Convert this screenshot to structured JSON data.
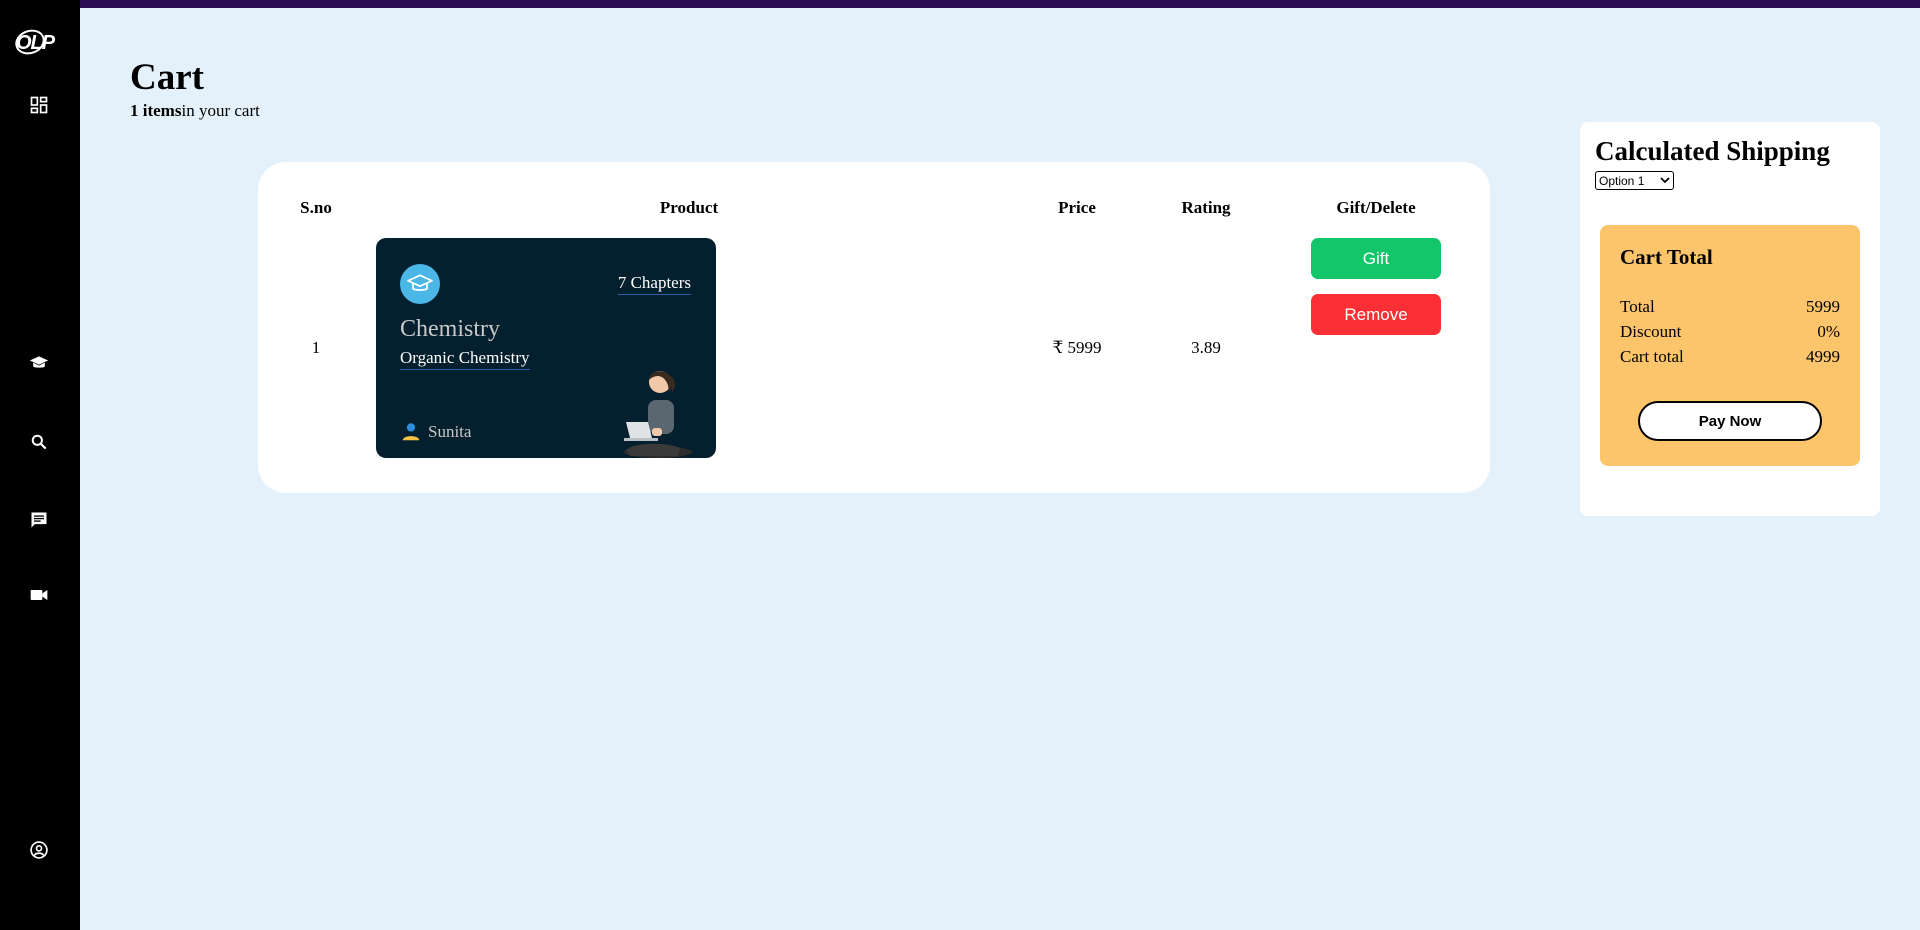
{
  "brand": {
    "logo_text": "OLP"
  },
  "sidebar": {
    "items": [
      {
        "name": "dashboard",
        "icon": "dashboard-icon"
      },
      {
        "name": "courses",
        "icon": "graduation-cap-icon"
      },
      {
        "name": "search",
        "icon": "search-icon"
      },
      {
        "name": "messages",
        "icon": "chat-icon"
      },
      {
        "name": "videos",
        "icon": "video-camera-icon"
      },
      {
        "name": "profile",
        "icon": "account-circle-icon"
      }
    ]
  },
  "page": {
    "title": "Cart",
    "item_count_bold": "1 items",
    "item_count_rest": "in your cart"
  },
  "cart_table": {
    "headers": [
      "S.no",
      "Product",
      "Price",
      "Rating",
      "Gift/Delete"
    ],
    "rows": [
      {
        "sno": "1",
        "course": {
          "chapters": "7 Chapters",
          "name": "Chemistry",
          "subject": "Organic Chemistry",
          "instructor": "Sunita",
          "icon": "graduation-cap-icon",
          "card_color": "#04202e"
        },
        "price": "₹ 5999",
        "rating": "3.89",
        "gift_label": "Gift",
        "remove_label": "Remove"
      }
    ]
  },
  "shipping": {
    "title": "Calculated Shipping",
    "selected_option": "Option 1"
  },
  "cart_total": {
    "title": "Cart Total",
    "rows": [
      {
        "label": "Total",
        "value": "5999"
      },
      {
        "label": "Discount",
        "value": "0%"
      },
      {
        "label": "Cart total",
        "value": "4999"
      }
    ],
    "pay_label": "Pay Now"
  },
  "colors": {
    "background": "#e4f1fb",
    "sidebar": "#000000",
    "topbar": "#2a0f55",
    "gift": "#13c56b",
    "remove": "#fc3034",
    "cart_total_box": "#fdc56b"
  }
}
